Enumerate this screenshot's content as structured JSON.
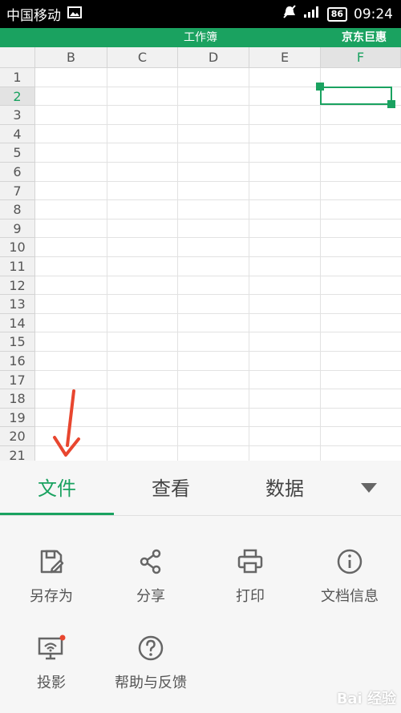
{
  "status_bar": {
    "carrier": "中国移动",
    "battery": "86",
    "time": "09:24"
  },
  "title_bar": {
    "title": "工作簿",
    "promo": "京东巨惠"
  },
  "sheet": {
    "columns": [
      "B",
      "C",
      "D",
      "E",
      "F"
    ],
    "rows": [
      "1",
      "2",
      "3",
      "4",
      "5",
      "6",
      "7",
      "8",
      "9",
      "10",
      "11",
      "12",
      "13",
      "14",
      "15",
      "16",
      "17",
      "18",
      "19",
      "20",
      "21"
    ],
    "selected_cell": "F2"
  },
  "tabs": [
    "文件",
    "查看",
    "数据"
  ],
  "file_menu": {
    "items": [
      "另存为",
      "分享",
      "打印",
      "文档信息",
      "投影",
      "帮助与反馈"
    ]
  },
  "watermark": "Bai 经验"
}
